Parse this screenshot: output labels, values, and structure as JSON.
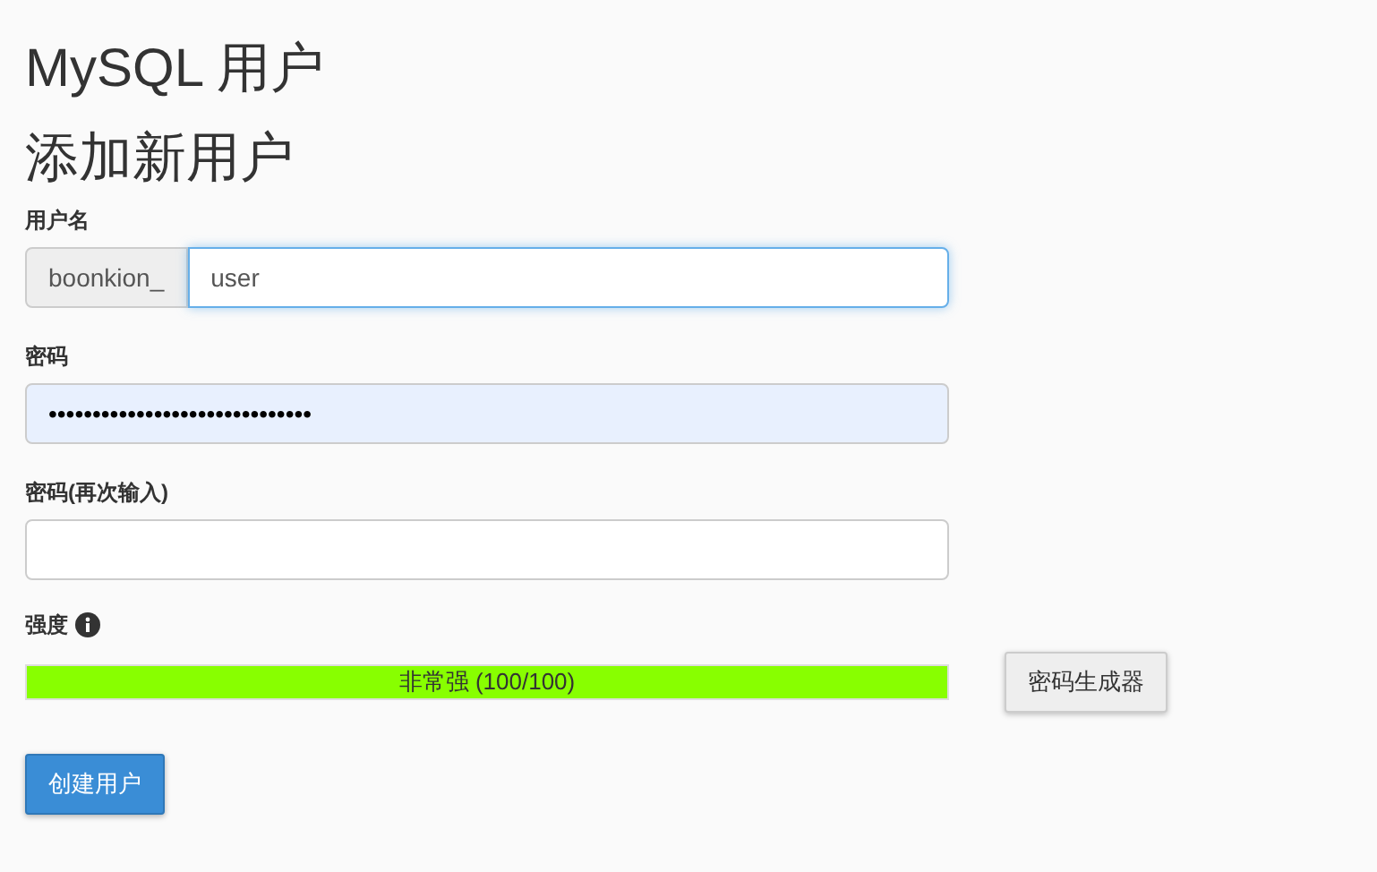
{
  "page_title": "MySQL 用户",
  "section_title": "添加新用户",
  "username": {
    "label": "用户名",
    "prefix": "boonkion_",
    "value": "user",
    "focused": true
  },
  "password": {
    "label": "密码",
    "value": "••••••••••••••••••••••••••••••",
    "autofilled": true
  },
  "password_again": {
    "label": "密码(再次输入)",
    "autofilled": false
  },
  "strength": {
    "label": "强度",
    "reading": "非常强 (100/100)",
    "level": 1,
    "color": "#88ff00"
  },
  "generator_button": "密码生成器",
  "create_button": "创建用户"
}
